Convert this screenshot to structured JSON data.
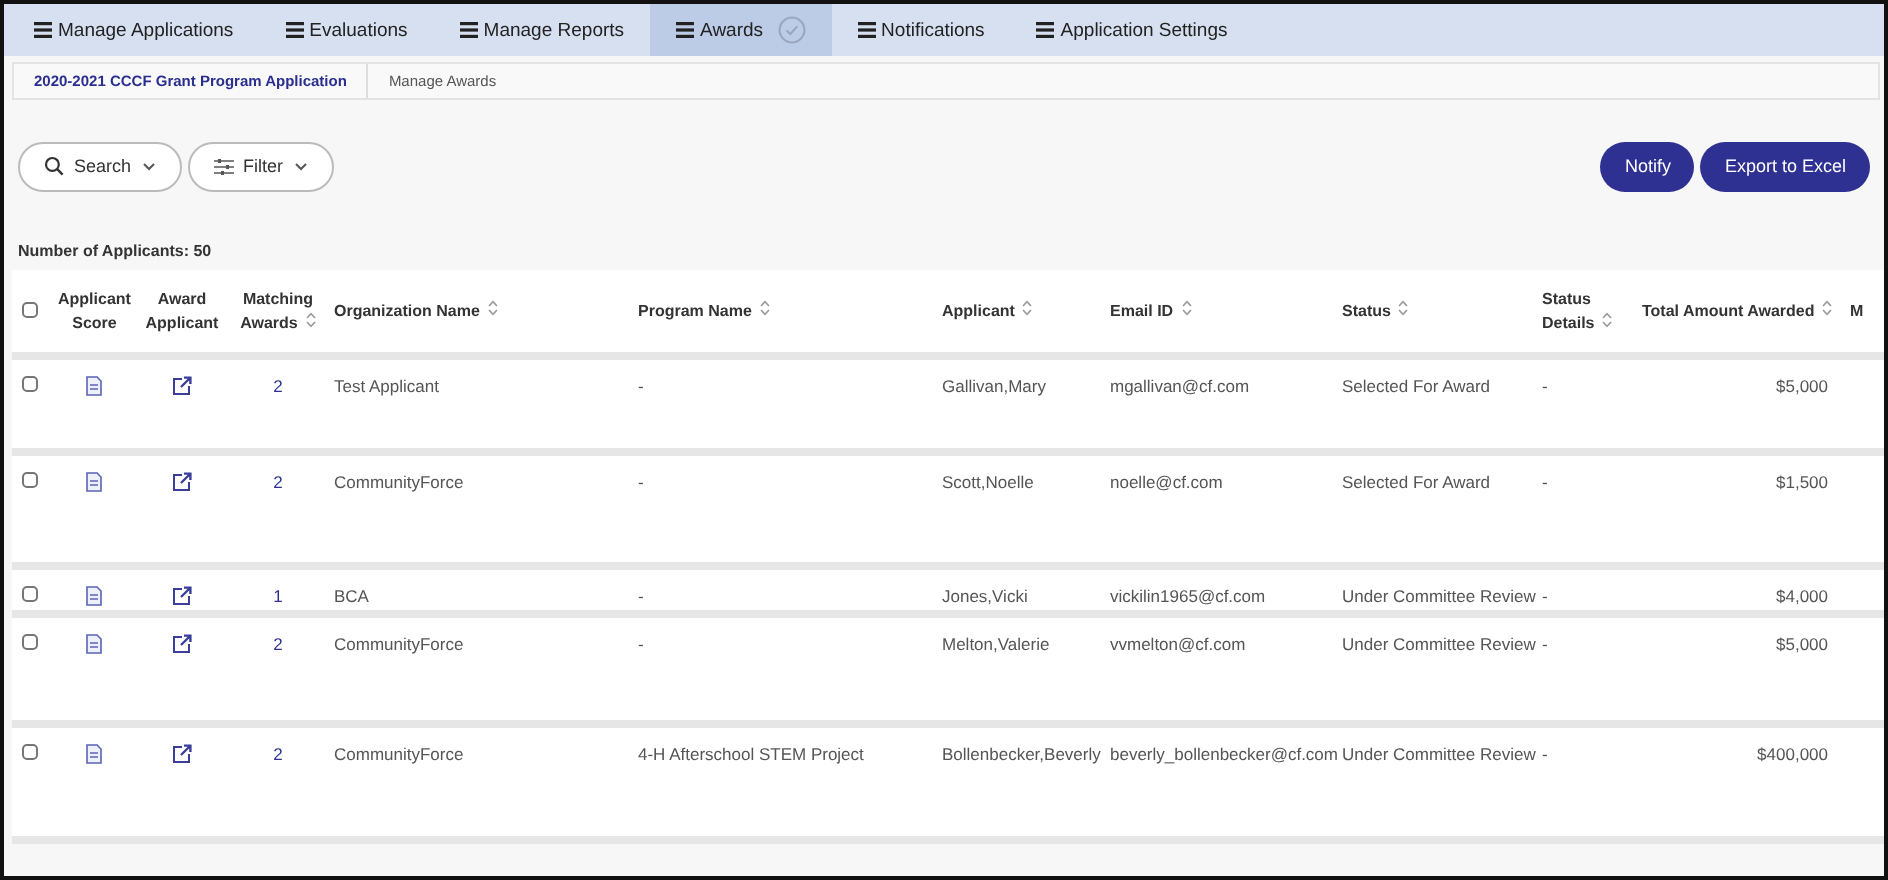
{
  "nav_tabs": [
    {
      "label": "Manage Applications",
      "selected": false
    },
    {
      "label": "Evaluations",
      "selected": false
    },
    {
      "label": "Manage Reports",
      "selected": false
    },
    {
      "label": "Awards",
      "selected": true
    },
    {
      "label": "Notifications",
      "selected": false
    },
    {
      "label": "Application Settings",
      "selected": false
    }
  ],
  "breadcrumb": [
    "2020-2021 CCCF Grant Program Application",
    "Manage Awards"
  ],
  "toolbar": {
    "search": "Search",
    "filter": "Filter",
    "buttons": [
      "Notify",
      "Export to Excel"
    ]
  },
  "applicant_count": "Number of Applicants: 50",
  "table": {
    "select_all_checked": false,
    "columns": [
      {
        "label": "Applicant Score",
        "sortable": false
      },
      {
        "label": "Award Applicant",
        "sortable": false
      },
      {
        "label": "Matching Awards",
        "sortable": true
      },
      {
        "label": "Organization Name",
        "sortable": true
      },
      {
        "label": "Program Name",
        "sortable": true
      },
      {
        "label": "Applicant",
        "sortable": true
      },
      {
        "label": "Email ID",
        "sortable": true
      },
      {
        "label": "Status",
        "sortable": true
      },
      {
        "label": "Status Details",
        "sortable": true
      },
      {
        "label": "Total Amount Awarded",
        "sortable": true
      },
      {
        "label": "M",
        "sortable": false
      }
    ],
    "rows": [
      {
        "checked": false,
        "matching": "2",
        "organization": "Test Applicant",
        "program": "-",
        "applicant": "Gallivan,Mary",
        "email": "mgallivan@cf.com",
        "status": "Selected For Award",
        "status_details": "-",
        "total": "$5,000"
      },
      {
        "checked": false,
        "matching": "2",
        "organization": "CommunityForce",
        "program": "-",
        "applicant": "Scott,Noelle",
        "email": "noelle@cf.com",
        "status": "Selected For Award",
        "status_details": "-",
        "total": "$1,500"
      },
      {
        "checked": false,
        "matching": "1",
        "organization": "BCA",
        "program": "-",
        "applicant": "Jones,Vicki",
        "email": "vickilin1965@cf.com",
        "status": "Under Committee Review",
        "status_details": "-",
        "total": "$4,000"
      },
      {
        "checked": false,
        "matching": "2",
        "organization": "CommunityForce",
        "program": "-",
        "applicant": "Melton,Valerie",
        "email": "vvmelton@cf.com",
        "status": "Under Committee Review",
        "status_details": "-",
        "total": "$5,000"
      },
      {
        "checked": false,
        "matching": "2",
        "organization": "CommunityForce",
        "program": "4-H Afterschool STEM Project",
        "applicant": "Bollenbecker,Beverly",
        "email": "beverly_bollenbecker@cf.com",
        "status": "Under Committee Review",
        "status_details": "-",
        "total": "$400,000"
      }
    ]
  }
}
